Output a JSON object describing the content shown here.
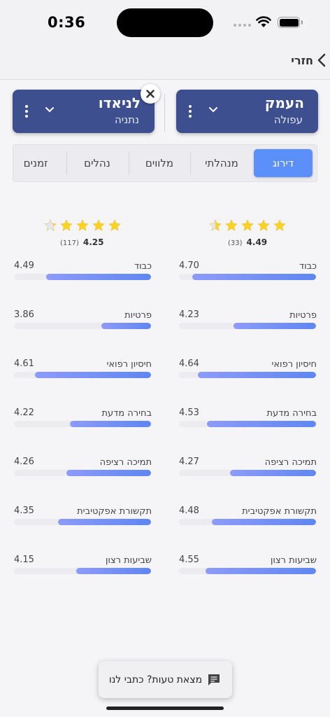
{
  "status_bar": {
    "time": "0:36"
  },
  "nav": {
    "back_label": "חזרי"
  },
  "cards": {
    "right": {
      "title": "העמק",
      "subtitle": "עפולה"
    },
    "left": {
      "title": "לניאדו",
      "subtitle": "נתניה"
    }
  },
  "tabs": [
    {
      "label": "דירוג",
      "active": true
    },
    {
      "label": "מנהלתי",
      "active": false
    },
    {
      "label": "מלווים",
      "active": false
    },
    {
      "label": "נהלים",
      "active": false
    },
    {
      "label": "זמנים",
      "active": false
    }
  ],
  "ratings": {
    "right": {
      "score": "4.49",
      "count": "(33)",
      "stars_value": 4.49,
      "metrics": [
        {
          "label": "כבוד",
          "value": "4.70",
          "num": 4.7
        },
        {
          "label": "פרטיות",
          "value": "4.23",
          "num": 4.23
        },
        {
          "label": "חיסיון רפואי",
          "value": "4.64",
          "num": 4.64
        },
        {
          "label": "בחירה מדעת",
          "value": "4.53",
          "num": 4.53
        },
        {
          "label": "תמיכה רציפה",
          "value": "4.27",
          "num": 4.27
        },
        {
          "label": "תקשורת אפקטיבית",
          "value": "4.48",
          "num": 4.48
        },
        {
          "label": "שביעות רצון",
          "value": "4.55",
          "num": 4.55
        }
      ]
    },
    "left": {
      "score": "4.25",
      "count": "(117)",
      "stars_value": 4.25,
      "metrics": [
        {
          "label": "כבוד",
          "value": "4.49",
          "num": 4.49
        },
        {
          "label": "פרטיות",
          "value": "3.86",
          "num": 3.86
        },
        {
          "label": "חיסיון רפואי",
          "value": "4.61",
          "num": 4.61
        },
        {
          "label": "בחירה מדעת",
          "value": "4.22",
          "num": 4.22
        },
        {
          "label": "תמיכה רציפה",
          "value": "4.26",
          "num": 4.26
        },
        {
          "label": "תקשורת אפקטיבית",
          "value": "4.35",
          "num": 4.35
        },
        {
          "label": "שביעות רצון",
          "value": "4.15",
          "num": 4.15
        }
      ]
    }
  },
  "feedback": {
    "label": "מצאת טעות? כתבי לנו"
  },
  "colors": {
    "card": "#3d4f8f",
    "tab_active": "#5b8ff9",
    "bar_start": "#8d9bfa",
    "bar_end": "#5f86f1",
    "star": "#ffd21f"
  }
}
